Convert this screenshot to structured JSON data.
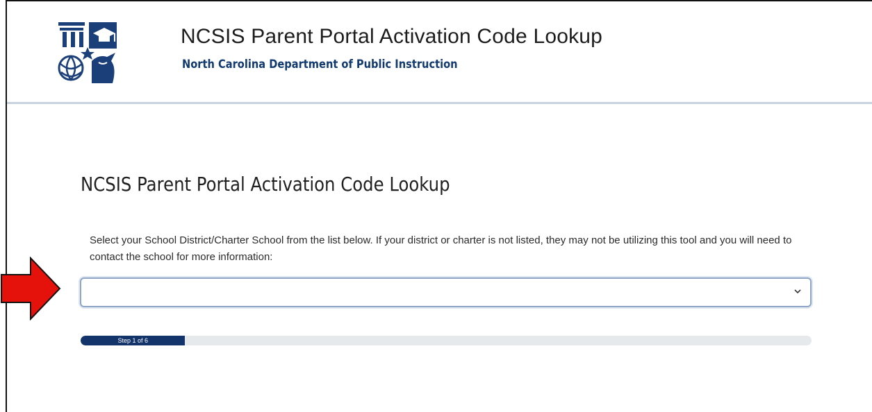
{
  "header": {
    "title": "NCSIS Parent Portal Activation Code Lookup",
    "subtitle": "North Carolina Department of Public Instruction",
    "logo_icon": "ncdpi-logo-icon"
  },
  "main": {
    "title": "NCSIS Parent Portal Activation Code Lookup",
    "instructions": "Select your School District/Charter School from the list below. If your district or charter is not listed, they may not be utilizing this tool and you will need to contact the school for more information:",
    "district_select": {
      "value": "",
      "placeholder": ""
    },
    "progress": {
      "label": "Step 1 of 6",
      "current_step": 1,
      "total_steps": 6,
      "fill_fraction": 0.143
    }
  },
  "annotation": {
    "icon": "red-arrow-icon",
    "color": "#e5120c"
  },
  "colors": {
    "brand_navy": "#13346b",
    "subtitle_blue": "#123a70",
    "header_rule": "#c8d2df",
    "select_border": "#8fa6c6",
    "progress_track": "#e6e9ec"
  }
}
